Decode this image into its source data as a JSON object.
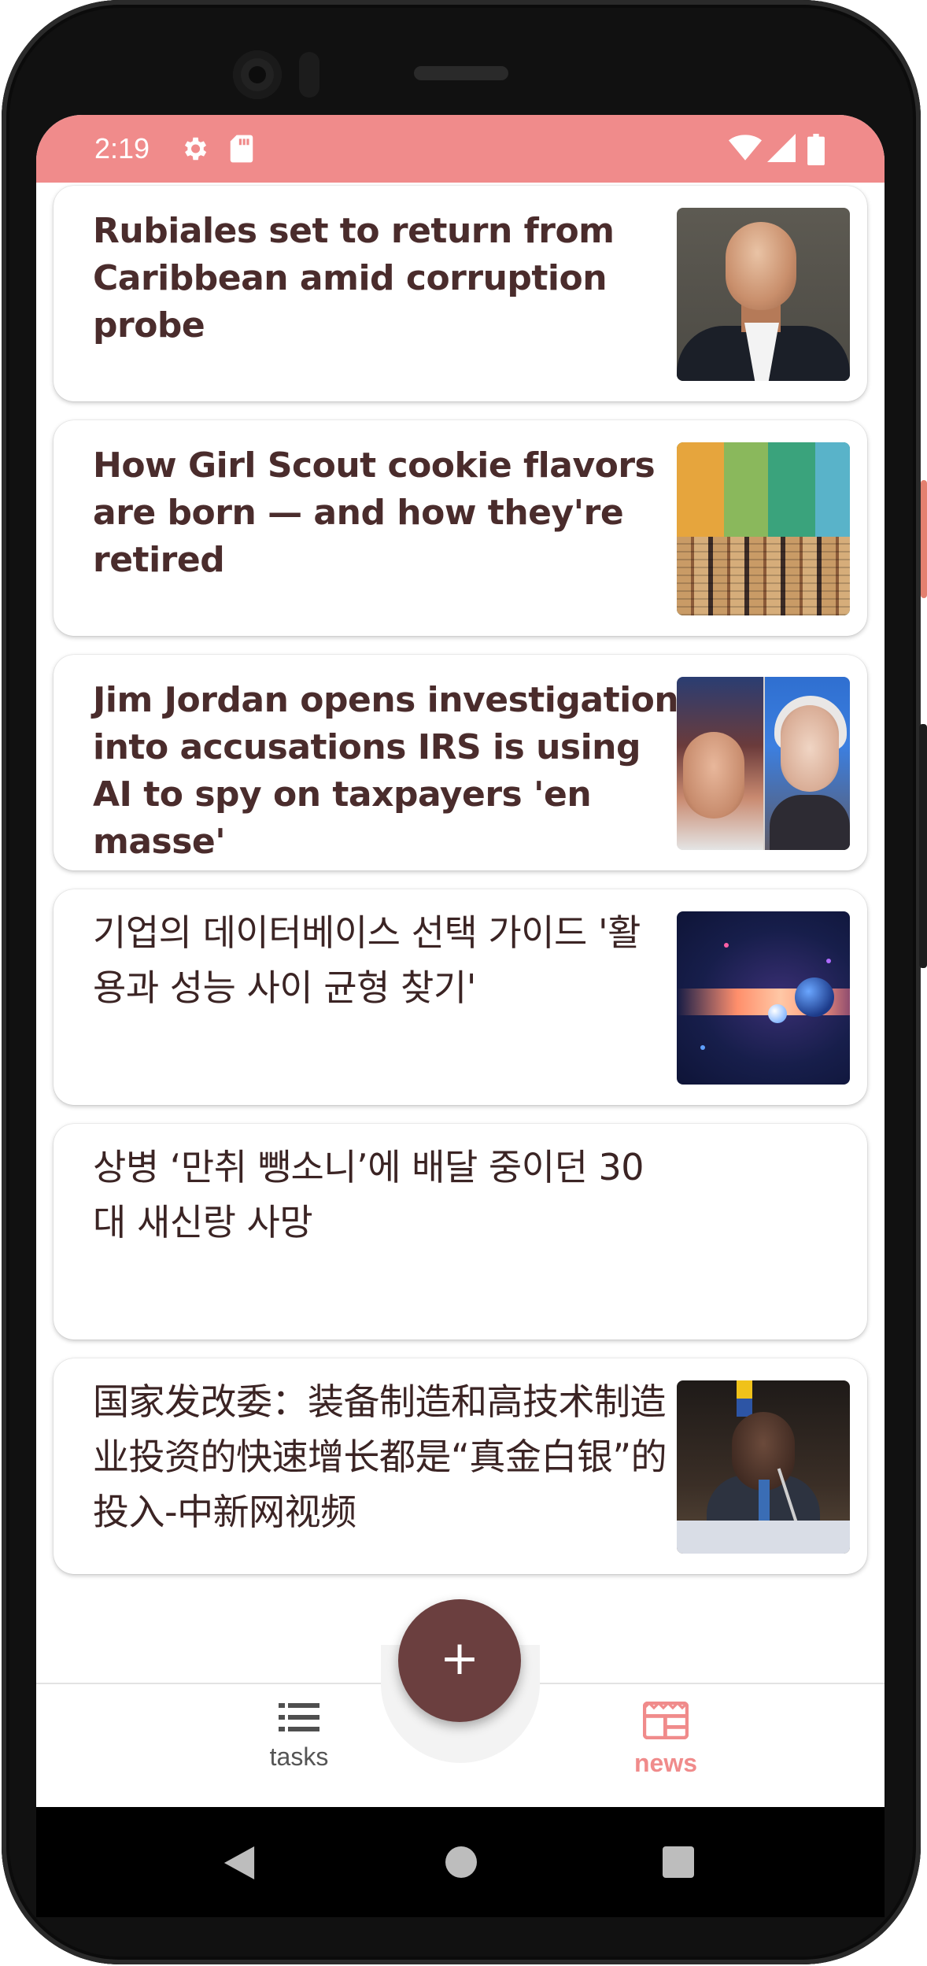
{
  "status_bar": {
    "time": "2:19",
    "background": "#f08b8b",
    "icons": [
      "gear-icon",
      "sd-card-icon",
      "wifi-icon",
      "cellular-icon",
      "battery-icon"
    ]
  },
  "articles": [
    {
      "title": "Rubiales set to return from Caribbean amid corruption probe",
      "has_thumbnail": true
    },
    {
      "title": "How Girl Scout cookie flavors are born — and how they're retired",
      "has_thumbnail": true
    },
    {
      "title": "Jim Jordan opens investigation into accusations IRS is using AI to spy on taxpayers 'en masse'",
      "has_thumbnail": true
    },
    {
      "title": "기업의 데이터베이스 선택 가이드 '활용과 성능 사이 균형 찾기'",
      "has_thumbnail": true
    },
    {
      "title": "상병 ‘만취 뺑소니’에 배달 중이던 30대 새신랑 사망",
      "has_thumbnail": false
    },
    {
      "title": "国家发改委：装备制造和高技术制造业投资的快速增长都是“真金白银”的投入-中新网视频",
      "has_thumbnail": true
    }
  ],
  "fab": {
    "label": "+",
    "color": "#6b3f3f"
  },
  "bottom_nav": {
    "tasks_label": "tasks",
    "news_label": "news",
    "selected": "news",
    "accent": "#f08b8b"
  }
}
